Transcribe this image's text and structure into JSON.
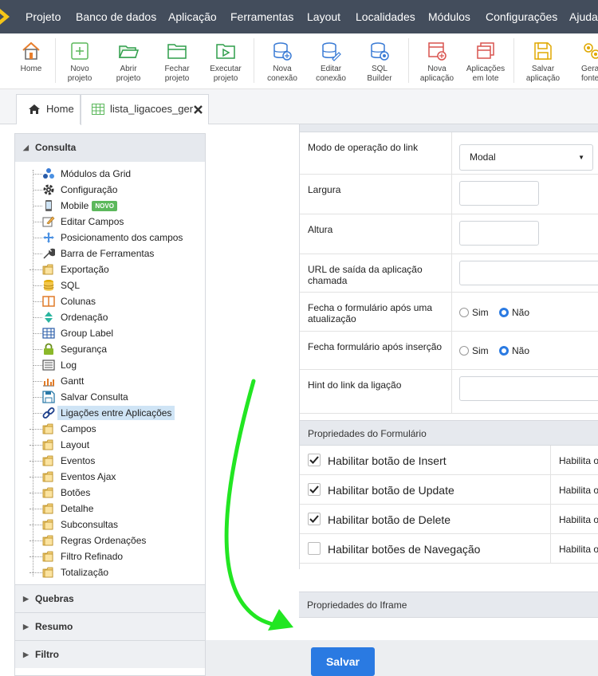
{
  "menubar": {
    "items": [
      "Projeto",
      "Banco de dados",
      "Aplicação",
      "Ferramentas",
      "Layout",
      "Localidades",
      "Módulos",
      "Configurações",
      "Ajuda"
    ]
  },
  "toolbar": {
    "buttons": [
      {
        "label1": "Home",
        "label2": "",
        "icon": "home-icon"
      },
      {
        "label1": "Novo",
        "label2": "projeto",
        "icon": "new-project-icon"
      },
      {
        "label1": "Abrir",
        "label2": "projeto",
        "icon": "open-folder-icon"
      },
      {
        "label1": "Fechar",
        "label2": "projeto",
        "icon": "close-folder-icon"
      },
      {
        "label1": "Executar",
        "label2": "projeto",
        "icon": "run-project-icon"
      },
      {
        "label1": "Nova",
        "label2": "conexão",
        "icon": "new-connection-icon"
      },
      {
        "label1": "Editar",
        "label2": "conexão",
        "icon": "edit-connection-icon"
      },
      {
        "label1": "SQL",
        "label2": "Builder",
        "icon": "sql-builder-icon"
      },
      {
        "label1": "Nova",
        "label2": "aplicação",
        "icon": "new-app-icon"
      },
      {
        "label1": "Aplicações",
        "label2": "em lote",
        "icon": "batch-apps-icon"
      },
      {
        "label1": "Salvar",
        "label2": "aplicação",
        "icon": "save-app-icon"
      },
      {
        "label1": "Gera",
        "label2": "fonte",
        "icon": "generate-source-icon"
      }
    ]
  },
  "tabs": {
    "home": "Home",
    "app": "lista_ligacoes_ger"
  },
  "sidebar": {
    "consulta": "Consulta",
    "items": [
      {
        "label": "Módulos da Grid",
        "icon": "grid-modules-icon"
      },
      {
        "label": "Configuração",
        "icon": "gear-icon"
      },
      {
        "label": "Mobile",
        "icon": "mobile-icon",
        "badge": "NOVO"
      },
      {
        "label": "Editar Campos",
        "icon": "edit-fields-icon"
      },
      {
        "label": "Posicionamento dos campos",
        "icon": "move-icon"
      },
      {
        "label": "Barra de Ferramentas",
        "icon": "wrench-icon"
      },
      {
        "label": "Exportação",
        "icon": "folder-icon"
      },
      {
        "label": "SQL",
        "icon": "database-icon"
      },
      {
        "label": "Colunas",
        "icon": "columns-icon"
      },
      {
        "label": "Ordenação",
        "icon": "sort-icon"
      },
      {
        "label": "Group Label",
        "icon": "table-icon"
      },
      {
        "label": "Segurança",
        "icon": "lock-icon"
      },
      {
        "label": "Log",
        "icon": "log-icon"
      },
      {
        "label": "Gantt",
        "icon": "gantt-icon"
      },
      {
        "label": "Salvar Consulta",
        "icon": "save-icon"
      },
      {
        "label": "Ligações entre Aplicações",
        "icon": "link-icon"
      },
      {
        "label": "Campos",
        "icon": "folder-icon"
      },
      {
        "label": "Layout",
        "icon": "folder-icon"
      },
      {
        "label": "Eventos",
        "icon": "folder-icon"
      },
      {
        "label": "Eventos Ajax",
        "icon": "folder-icon"
      },
      {
        "label": "Botões",
        "icon": "folder-icon"
      },
      {
        "label": "Detalhe",
        "icon": "folder-icon"
      },
      {
        "label": "Subconsultas",
        "icon": "folder-icon"
      },
      {
        "label": "Regras Ordenações",
        "icon": "folder-icon"
      },
      {
        "label": "Filtro Refinado",
        "icon": "folder-icon"
      },
      {
        "label": "Totalização",
        "icon": "folder-icon"
      }
    ],
    "quebras": "Quebras",
    "resumo": "Resumo",
    "filtro": "Filtro"
  },
  "form": {
    "modo_label": "Modo de operação do link",
    "modo_value": "Modal",
    "largura_label": "Largura",
    "altura_label": "Altura",
    "url_label": "URL de saída da aplicação chamada",
    "fecha_atualizacao_label": "Fecha o formulário após uma atualização",
    "fecha_insercao_label": "Fecha formulário após inserção",
    "sim": "Sim",
    "nao": "Não",
    "hint_label": "Hint do link da ligação",
    "props_formulario": "Propriedades do Formulário",
    "chk_insert": "Habilitar botão de Insert",
    "chk_update": "Habilitar botão de Update",
    "chk_delete": "Habilitar botão de Delete",
    "chk_nav": "Habilitar botões de Navegação",
    "hint_text": "Habilita o",
    "props_iframe": "Propriedades do Iframe"
  },
  "footer": {
    "save_label": "Salvar"
  },
  "colors": {
    "menubar": "#434d5c",
    "accent": "#2a7ae2",
    "arrow": "#22e622",
    "badge": "#5cb85c"
  }
}
